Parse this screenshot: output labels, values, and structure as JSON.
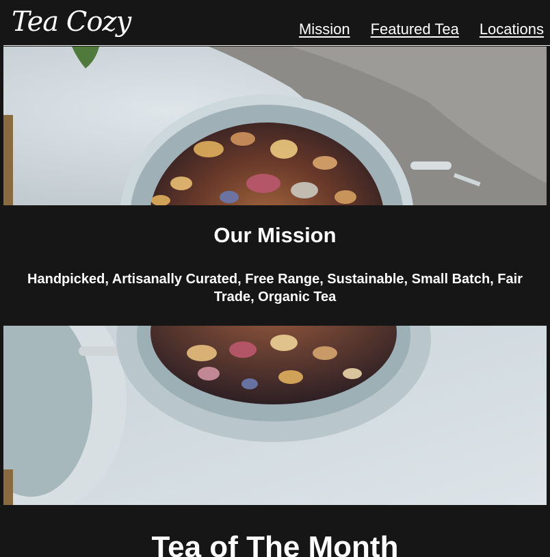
{
  "header": {
    "logo_text": "Tea Cozy",
    "nav": [
      {
        "label": "Mission"
      },
      {
        "label": "Featured Tea"
      },
      {
        "label": "Locations"
      }
    ]
  },
  "mission": {
    "title": "Our Mission",
    "text": "Handpicked, Artisanally Curated, Free Range, Sustainable, Small Batch, Fair Trade, Organic Tea"
  },
  "tea_of_month": {
    "title": "Tea of The Month"
  },
  "colors": {
    "background": "#161616",
    "text": "#ffffff"
  }
}
